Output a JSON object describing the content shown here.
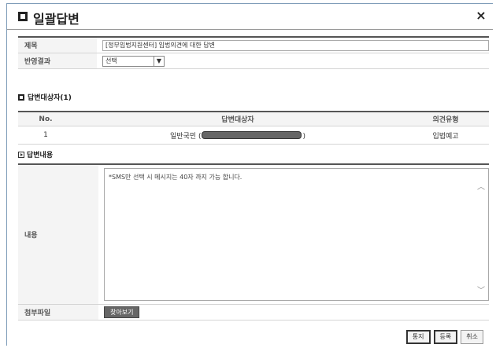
{
  "dialog": {
    "title": "일괄답변",
    "close_label": "×"
  },
  "form": {
    "subject_label": "제목",
    "subject_value": "[정부입법지원센터] 입법의견에 대한 답변",
    "result_label": "반영결과",
    "result_value": "선택"
  },
  "targets": {
    "heading": "답변대상자(1)",
    "columns": [
      "No.",
      "답변대상자",
      "의견유형"
    ],
    "rows": [
      {
        "no": "1",
        "name_prefix": "일반국민 (",
        "name_suffix": ")",
        "type": "입법예고"
      }
    ]
  },
  "answer": {
    "heading": "답변내용",
    "content_label": "내용",
    "content_text": "*SMS만 선택 시 메시지는 40자 까지 가능 합니다.",
    "attach_label": "첨부파일",
    "browse_label": "찾아보기"
  },
  "buttons": {
    "send": "통지",
    "register": "등록",
    "cancel": "취소"
  },
  "icons": [
    "window-square-icon",
    "close-icon",
    "section-square-icon",
    "section-play-icon",
    "chevron-down-icon",
    "scroll-up-icon",
    "scroll-down-icon"
  ]
}
